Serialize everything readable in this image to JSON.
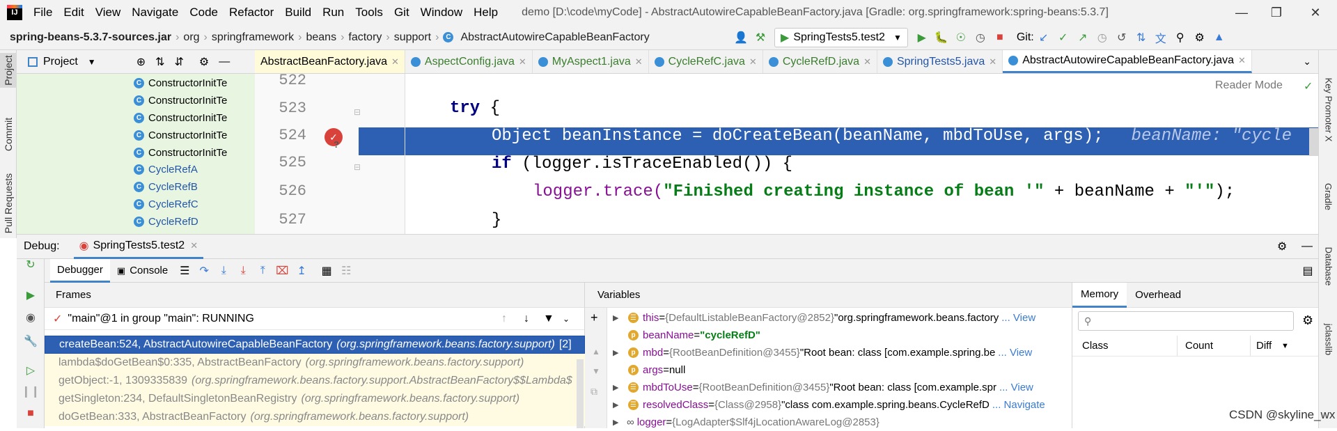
{
  "menubar": {
    "logo": "IJ",
    "items": [
      "File",
      "Edit",
      "View",
      "Navigate",
      "Code",
      "Refactor",
      "Build",
      "Run",
      "Tools",
      "Git",
      "Window",
      "Help"
    ],
    "title": "demo [D:\\code\\myCode] - AbstractAutowireCapableBeanFactory.java [Gradle: org.springframework:spring-beans:5.3.7]"
  },
  "breadcrumb": {
    "root": "spring-beans-5.3.7-sources.jar",
    "parts": [
      "org",
      "springframework",
      "beans",
      "factory",
      "support"
    ],
    "file": "AbstractAutowireCapableBeanFactory"
  },
  "toolbar": {
    "run_config": "SpringTests5.test2",
    "git_label": "Git:"
  },
  "project": {
    "title": "Project",
    "items": [
      "ConstructorInitTe",
      "ConstructorInitTe",
      "ConstructorInitTe",
      "ConstructorInitTe",
      "ConstructorInitTe",
      "CycleRefA",
      "CycleRefB",
      "CycleRefC",
      "CycleRefD"
    ]
  },
  "side_tabs": {
    "left": [
      "Project",
      "Commit",
      "Pull Requests"
    ],
    "right": [
      "Key Promoter X",
      "Gradle",
      "Database",
      "jclasslib"
    ]
  },
  "tabs": [
    {
      "label": "AbstractBeanFactory.java",
      "active": false
    },
    {
      "label": "AspectConfig.java",
      "active": false
    },
    {
      "label": "MyAspect1.java",
      "active": false
    },
    {
      "label": "CycleRefC.java",
      "active": false
    },
    {
      "label": "CycleRefD.java",
      "active": false
    },
    {
      "label": "SpringTests5.java",
      "active": false
    },
    {
      "label": "AbstractAutowireCapableBeanFactory.java",
      "active": true
    }
  ],
  "editor": {
    "reader_mode": "Reader Mode",
    "lines": [
      {
        "num": "522",
        "kw": "",
        "text": ""
      },
      {
        "num": "523",
        "kw": "try",
        "text": " {"
      },
      {
        "num": "524",
        "kw": "",
        "text": "Object beanInstance = doCreateBean(beanName, mbdToUse, args);",
        "hint": "beanName: \"cycle"
      },
      {
        "num": "525",
        "kw": "if",
        "text": " (logger.isTraceEnabled()) {"
      },
      {
        "num": "526",
        "kw": "",
        "pre": "logger.trace(",
        "str": "\"Finished creating instance of bean '\"",
        "post": " + beanName + ",
        "str2": "\"'\"",
        "end": ");"
      },
      {
        "num": "527",
        "kw": "",
        "text": "}"
      }
    ]
  },
  "debug": {
    "label": "Debug:",
    "session": "SpringTests5.test2",
    "tabs": [
      "Debugger",
      "Console"
    ],
    "frames_header": "Frames",
    "thread": "\"main\"@1 in group \"main\": RUNNING",
    "frames": [
      {
        "method": "createBean:524, AbstractAutowireCapableBeanFactory",
        "pkg": "(org.springframework.beans.factory.support)",
        "extra": "[2]",
        "selected": true
      },
      {
        "method": "lambda$doGetBean$0:335, AbstractBeanFactory",
        "pkg": "(org.springframework.beans.factory.support)",
        "selected": false
      },
      {
        "method": "getObject:-1, 1309335839",
        "pkg": "(org.springframework.beans.factory.support.AbstractBeanFactory$$Lambda$",
        "selected": false
      },
      {
        "method": "getSingleton:234, DefaultSingletonBeanRegistry",
        "pkg": "(org.springframework.beans.factory.support)",
        "selected": false
      },
      {
        "method": "doGetBean:333, AbstractBeanFactory",
        "pkg": "(org.springframework.beans.factory.support)",
        "selected": false
      }
    ],
    "variables_header": "Variables",
    "variables": [
      {
        "name": "this",
        "eq": " = ",
        "type": "{DefaultListableBeanFactory@2852}",
        "value": " \"org.springframework.beans.factory",
        "link": "... View",
        "expand": true
      },
      {
        "name": "beanName",
        "eq": " = ",
        "type": "",
        "value": "\"cycleRefD\"",
        "link": "",
        "expand": false
      },
      {
        "name": "mbd",
        "eq": " = ",
        "type": "{RootBeanDefinition@3455}",
        "value": " \"Root bean: class [com.example.spring.be",
        "link": "... View",
        "expand": true
      },
      {
        "name": "args",
        "eq": " = ",
        "type": "",
        "value": "null",
        "link": "",
        "expand": false
      },
      {
        "name": "mbdToUse",
        "eq": " = ",
        "type": "{RootBeanDefinition@3455}",
        "value": " \"Root bean: class [com.example.spr",
        "link": "... View",
        "expand": true
      },
      {
        "name": "resolvedClass",
        "eq": " = ",
        "type": "{Class@2958}",
        "value": " \"class com.example.spring.beans.CycleRefD",
        "link": "... Navigate",
        "expand": true
      },
      {
        "name": "logger",
        "eq": " = ",
        "type": "{LogAdapter$Slf4jLocationAwareLog@2853}",
        "value": "",
        "link": "",
        "expand": true
      }
    ],
    "memory_tabs": [
      "Memory",
      "Overhead"
    ],
    "memory_columns": [
      "Class",
      "Count",
      "Diff"
    ]
  },
  "watermark": "CSDN @skyline_wx"
}
